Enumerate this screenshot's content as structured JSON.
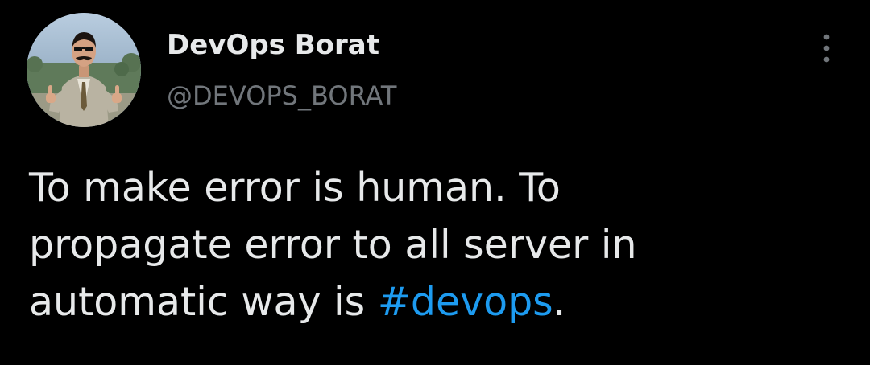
{
  "tweet": {
    "author": {
      "display_name": "DevOps Borat",
      "handle": "@DEVOPS_BORAT"
    },
    "more_icon": "more-vertical-icon",
    "text_lines": [
      "To make error is human. To",
      "propagate error to all server in",
      "automatic way is "
    ],
    "hashtag": "#devops",
    "trailing": "."
  },
  "colors": {
    "background": "#000000",
    "primary_text": "#e7e9ea",
    "secondary_text": "#71767b",
    "link": "#1d9bf0"
  }
}
